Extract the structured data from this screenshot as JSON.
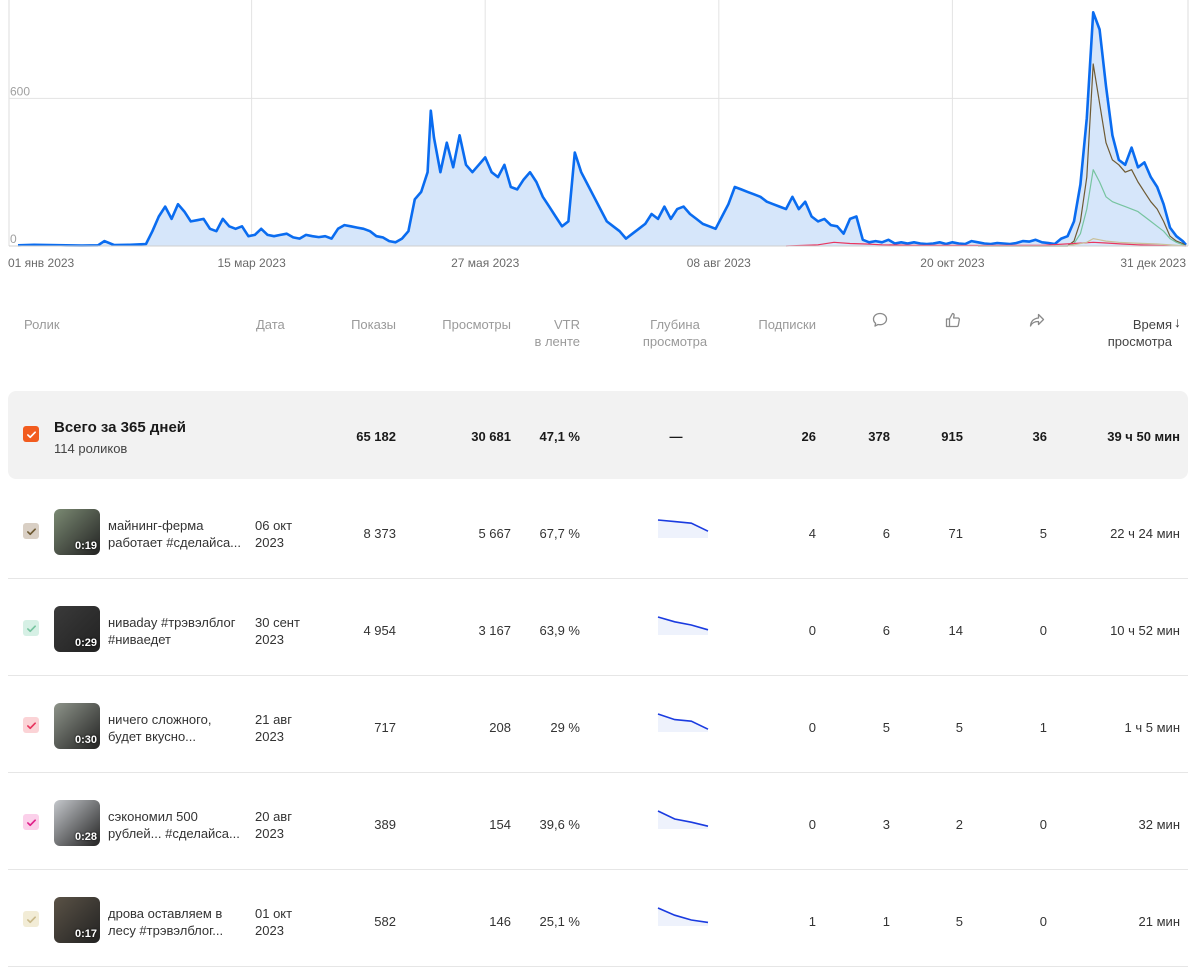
{
  "chart_data": {
    "type": "area",
    "x_ticks": [
      "01 янв 2023",
      "15 мар 2023",
      "27 мая 2023",
      "08 авг 2023",
      "20 окт 2023",
      "31 дек 2023"
    ],
    "y_ticks": [
      "0",
      "600"
    ],
    "ylim": [
      0,
      1000
    ],
    "xlim": [
      0,
      365
    ],
    "grid": true,
    "series": [
      {
        "color": "#0a6cf0",
        "fill": "#d6e6fa",
        "points": [
          [
            0,
            3
          ],
          [
            5,
            5
          ],
          [
            10,
            4
          ],
          [
            15,
            3
          ],
          [
            20,
            2
          ],
          [
            25,
            3
          ],
          [
            27,
            20
          ],
          [
            30,
            4
          ],
          [
            35,
            5
          ],
          [
            40,
            8
          ],
          [
            42,
            60
          ],
          [
            44,
            120
          ],
          [
            46,
            160
          ],
          [
            48,
            110
          ],
          [
            50,
            170
          ],
          [
            52,
            140
          ],
          [
            54,
            100
          ],
          [
            56,
            105
          ],
          [
            58,
            110
          ],
          [
            60,
            70
          ],
          [
            62,
            60
          ],
          [
            64,
            110
          ],
          [
            66,
            80
          ],
          [
            68,
            70
          ],
          [
            70,
            80
          ],
          [
            72,
            40
          ],
          [
            74,
            45
          ],
          [
            76,
            70
          ],
          [
            78,
            45
          ],
          [
            80,
            40
          ],
          [
            82,
            45
          ],
          [
            84,
            50
          ],
          [
            86,
            35
          ],
          [
            88,
            30
          ],
          [
            90,
            45
          ],
          [
            92,
            40
          ],
          [
            94,
            36
          ],
          [
            96,
            40
          ],
          [
            98,
            30
          ],
          [
            100,
            70
          ],
          [
            102,
            85
          ],
          [
            104,
            80
          ],
          [
            106,
            75
          ],
          [
            108,
            70
          ],
          [
            110,
            60
          ],
          [
            112,
            40
          ],
          [
            114,
            35
          ],
          [
            116,
            20
          ],
          [
            118,
            15
          ],
          [
            120,
            30
          ],
          [
            122,
            60
          ],
          [
            124,
            190
          ],
          [
            126,
            220
          ],
          [
            128,
            300
          ],
          [
            129,
            550
          ],
          [
            130,
            440
          ],
          [
            132,
            300
          ],
          [
            134,
            420
          ],
          [
            136,
            320
          ],
          [
            138,
            450
          ],
          [
            140,
            330
          ],
          [
            142,
            300
          ],
          [
            144,
            330
          ],
          [
            146,
            360
          ],
          [
            148,
            300
          ],
          [
            150,
            280
          ],
          [
            152,
            330
          ],
          [
            154,
            240
          ],
          [
            156,
            230
          ],
          [
            158,
            270
          ],
          [
            160,
            300
          ],
          [
            162,
            260
          ],
          [
            164,
            200
          ],
          [
            166,
            160
          ],
          [
            168,
            120
          ],
          [
            170,
            80
          ],
          [
            172,
            100
          ],
          [
            174,
            380
          ],
          [
            176,
            300
          ],
          [
            178,
            250
          ],
          [
            180,
            200
          ],
          [
            182,
            150
          ],
          [
            184,
            100
          ],
          [
            186,
            80
          ],
          [
            188,
            60
          ],
          [
            190,
            30
          ],
          [
            192,
            50
          ],
          [
            194,
            70
          ],
          [
            196,
            90
          ],
          [
            198,
            130
          ],
          [
            200,
            110
          ],
          [
            202,
            160
          ],
          [
            204,
            110
          ],
          [
            206,
            150
          ],
          [
            208,
            160
          ],
          [
            210,
            130
          ],
          [
            212,
            110
          ],
          [
            214,
            90
          ],
          [
            216,
            80
          ],
          [
            218,
            70
          ],
          [
            220,
            120
          ],
          [
            222,
            170
          ],
          [
            224,
            240
          ],
          [
            226,
            230
          ],
          [
            228,
            220
          ],
          [
            230,
            210
          ],
          [
            232,
            200
          ],
          [
            234,
            180
          ],
          [
            236,
            170
          ],
          [
            238,
            160
          ],
          [
            240,
            150
          ],
          [
            242,
            200
          ],
          [
            244,
            150
          ],
          [
            246,
            180
          ],
          [
            248,
            120
          ],
          [
            250,
            100
          ],
          [
            252,
            110
          ],
          [
            254,
            85
          ],
          [
            256,
            80
          ],
          [
            258,
            50
          ],
          [
            260,
            110
          ],
          [
            262,
            120
          ],
          [
            264,
            25
          ],
          [
            266,
            15
          ],
          [
            268,
            20
          ],
          [
            270,
            15
          ],
          [
            272,
            25
          ],
          [
            274,
            10
          ],
          [
            276,
            15
          ],
          [
            278,
            10
          ],
          [
            280,
            15
          ],
          [
            282,
            10
          ],
          [
            284,
            8
          ],
          [
            286,
            10
          ],
          [
            288,
            15
          ],
          [
            290,
            8
          ],
          [
            292,
            15
          ],
          [
            294,
            10
          ],
          [
            296,
            8
          ],
          [
            298,
            20
          ],
          [
            300,
            15
          ],
          [
            302,
            10
          ],
          [
            304,
            8
          ],
          [
            306,
            12
          ],
          [
            308,
            10
          ],
          [
            310,
            8
          ],
          [
            312,
            12
          ],
          [
            314,
            20
          ],
          [
            316,
            18
          ],
          [
            318,
            25
          ],
          [
            320,
            15
          ],
          [
            322,
            12
          ],
          [
            324,
            8
          ],
          [
            326,
            30
          ],
          [
            328,
            40
          ],
          [
            330,
            100
          ],
          [
            332,
            250
          ],
          [
            334,
            520
          ],
          [
            336,
            950
          ],
          [
            338,
            880
          ],
          [
            340,
            650
          ],
          [
            342,
            450
          ],
          [
            344,
            350
          ],
          [
            346,
            330
          ],
          [
            348,
            400
          ],
          [
            350,
            320
          ],
          [
            352,
            340
          ],
          [
            354,
            280
          ],
          [
            356,
            240
          ],
          [
            358,
            170
          ],
          [
            360,
            75
          ],
          [
            362,
            40
          ],
          [
            364,
            20
          ],
          [
            365,
            5
          ]
        ]
      },
      {
        "color": "#6e5a33",
        "points": [
          [
            300,
            0
          ],
          [
            328,
            0
          ],
          [
            330,
            20
          ],
          [
            332,
            100
          ],
          [
            334,
            280
          ],
          [
            336,
            740
          ],
          [
            338,
            580
          ],
          [
            340,
            420
          ],
          [
            342,
            350
          ],
          [
            344,
            330
          ],
          [
            346,
            300
          ],
          [
            348,
            310
          ],
          [
            350,
            260
          ],
          [
            352,
            220
          ],
          [
            354,
            180
          ],
          [
            356,
            150
          ],
          [
            358,
            100
          ],
          [
            360,
            40
          ],
          [
            362,
            20
          ],
          [
            364,
            10
          ],
          [
            365,
            0
          ]
        ]
      },
      {
        "color": "#77c4a0",
        "points": [
          [
            300,
            0
          ],
          [
            328,
            0
          ],
          [
            330,
            10
          ],
          [
            332,
            50
          ],
          [
            334,
            150
          ],
          [
            336,
            310
          ],
          [
            338,
            260
          ],
          [
            340,
            200
          ],
          [
            342,
            180
          ],
          [
            344,
            170
          ],
          [
            346,
            160
          ],
          [
            348,
            150
          ],
          [
            350,
            140
          ],
          [
            352,
            120
          ],
          [
            354,
            100
          ],
          [
            356,
            80
          ],
          [
            358,
            60
          ],
          [
            360,
            30
          ],
          [
            362,
            15
          ],
          [
            365,
            0
          ]
        ]
      },
      {
        "color": "#e8365f",
        "points": [
          [
            240,
            0
          ],
          [
            250,
            5
          ],
          [
            255,
            15
          ],
          [
            260,
            10
          ],
          [
            265,
            8
          ],
          [
            270,
            5
          ],
          [
            280,
            3
          ],
          [
            290,
            3
          ],
          [
            300,
            2
          ],
          [
            320,
            3
          ],
          [
            330,
            10
          ],
          [
            336,
            15
          ],
          [
            340,
            12
          ],
          [
            345,
            8
          ],
          [
            350,
            5
          ],
          [
            355,
            3
          ],
          [
            365,
            0
          ]
        ]
      },
      {
        "color": "#c9c09a",
        "points": [
          [
            300,
            0
          ],
          [
            328,
            0
          ],
          [
            330,
            5
          ],
          [
            334,
            15
          ],
          [
            336,
            30
          ],
          [
            338,
            25
          ],
          [
            340,
            20
          ],
          [
            344,
            15
          ],
          [
            348,
            12
          ],
          [
            352,
            10
          ],
          [
            356,
            8
          ],
          [
            360,
            5
          ],
          [
            365,
            0
          ]
        ]
      }
    ]
  },
  "table": {
    "headers": {
      "video": "Ролик",
      "date": "Дата",
      "impressions": "Показы",
      "views": "Просмотры",
      "vtr": "VTR\nв ленте",
      "depth": "Глубина\nпросмотра",
      "subs": "Подписки",
      "watch_time": "Время\nпросмотра"
    },
    "sort_arrow": "↓",
    "icons": {
      "comments": "comment-icon",
      "likes": "like-icon",
      "shares": "share-icon"
    },
    "summary": {
      "title": "Всего за 365 дней",
      "subtitle": "114 роликов",
      "impressions": "65 182",
      "views": "30 681",
      "vtr": "47,1 %",
      "depth": "—",
      "subs": "26",
      "comments": "378",
      "likes": "915",
      "shares": "36",
      "watch_time": "39 ч 50 мин",
      "checkbox_color": "#f25c1f"
    },
    "rows": [
      {
        "title": "майнинг-ферма работает #сделайса...",
        "date": "06 окт 2023",
        "duration": "0:19",
        "impressions": "8 373",
        "views": "5 667",
        "vtr": "67,7 %",
        "subs": "4",
        "comments": "6",
        "likes": "71",
        "shares": "5",
        "watch_time": "22 ч 24 мин",
        "checkbox_color": "#d9cfc4",
        "check_color": "#6e5a33",
        "thumb_color": "#7b8a73",
        "depth": [
          0,
          0.1,
          0.2,
          0.7
        ]
      },
      {
        "title": "ниваday #трэвэлблог #ниваедет",
        "date": "30 сент 2023",
        "duration": "0:29",
        "impressions": "4 954",
        "views": "3 167",
        "vtr": "63,9 %",
        "subs": "0",
        "comments": "6",
        "likes": "14",
        "shares": "0",
        "watch_time": "10 ч 52 мин",
        "checkbox_color": "#d6f0e5",
        "check_color": "#77c4a0",
        "thumb_color": "#3a3a3a",
        "depth": [
          0,
          0.3,
          0.5,
          0.8
        ]
      },
      {
        "title": "ничего сложного, будет вкусно...",
        "date": "21 авг 2023",
        "duration": "0:30",
        "impressions": "717",
        "views": "208",
        "vtr": "29 %",
        "subs": "0",
        "comments": "5",
        "likes": "5",
        "shares": "1",
        "watch_time": "1 ч 5 мин",
        "checkbox_color": "#fbd3d6",
        "check_color": "#e8365f",
        "thumb_color": "#8e948a",
        "depth": [
          0,
          0.35,
          0.45,
          0.95
        ]
      },
      {
        "title": "сэкономил 500 рублей... #сделайса...",
        "date": "20 авг 2023",
        "duration": "0:28",
        "impressions": "389",
        "views": "154",
        "vtr": "39,6 %",
        "subs": "0",
        "comments": "3",
        "likes": "2",
        "shares": "0",
        "watch_time": "32 мин",
        "checkbox_color": "#fbd0ea",
        "check_color": "#e0218a",
        "thumb_color": "#c5c8cc",
        "depth": [
          0,
          0.5,
          0.7,
          0.95
        ]
      },
      {
        "title": "дрова оставляем в лесу #трэвэлблог...",
        "date": "01 окт 2023",
        "duration": "0:17",
        "impressions": "582",
        "views": "146",
        "vtr": "25,1 %",
        "subs": "1",
        "comments": "1",
        "likes": "5",
        "shares": "0",
        "watch_time": "21 мин",
        "checkbox_color": "#f2ecd6",
        "check_color": "#c9b98a",
        "thumb_color": "#5a5246",
        "depth": [
          0,
          0.45,
          0.75,
          0.9
        ]
      }
    ]
  }
}
